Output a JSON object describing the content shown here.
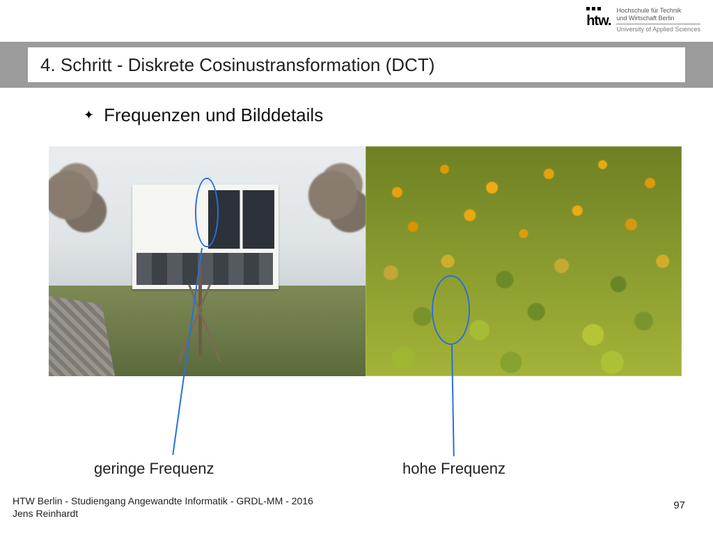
{
  "logo": {
    "mark": "htw.",
    "line1": "Hochschule für Technik",
    "line2": "und Wirtschaft Berlin",
    "line3": "University of Applied Sciences"
  },
  "title": "4. Schritt - Diskrete Cosinustransformation (DCT)",
  "bullet": {
    "marker": "✦",
    "text": "Frequenzen und Bilddetails"
  },
  "captions": {
    "low": "geringe Frequenz",
    "high": "hohe Frequenz"
  },
  "footer": {
    "line1": "HTW Berlin - Studiengang Angewandte Informatik - GRDL-MM - 2016",
    "line2": "Jens Reinhardt"
  },
  "page_number": "97",
  "annotation_color": "#2a6fdb"
}
